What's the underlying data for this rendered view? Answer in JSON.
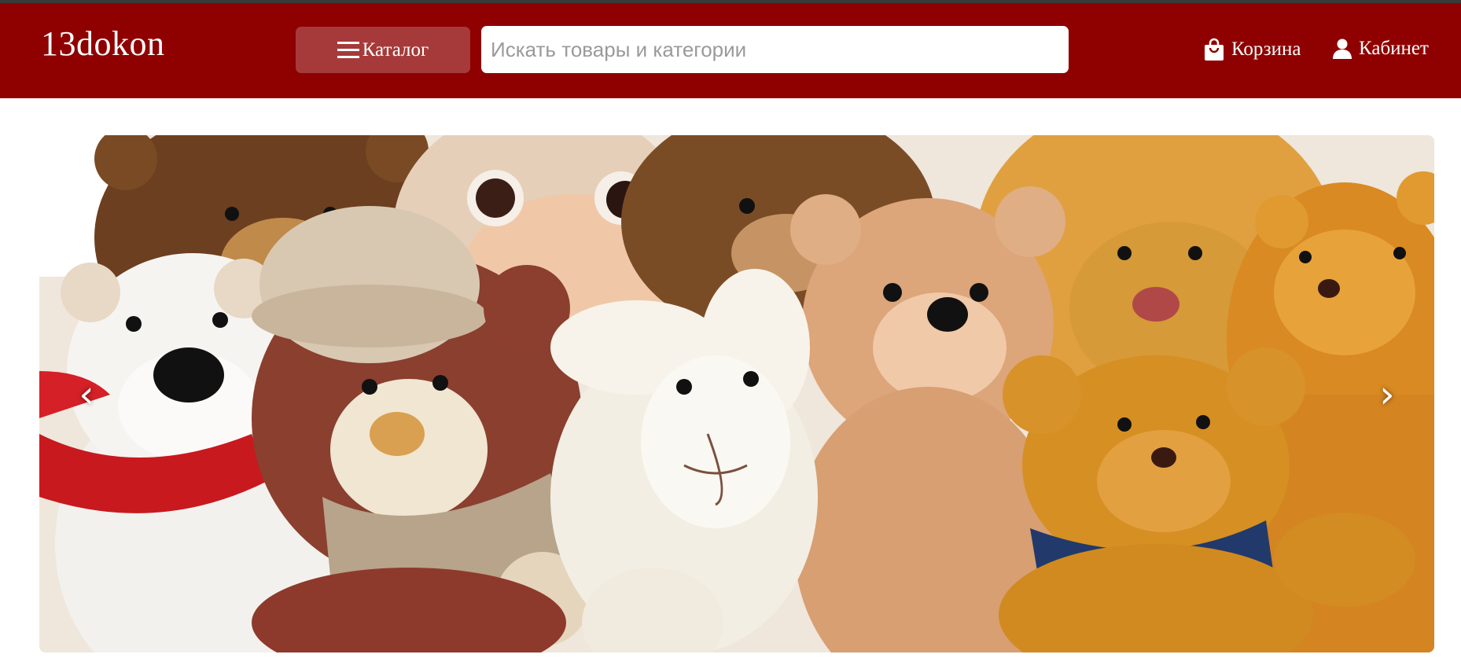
{
  "header": {
    "logo": "13dokon",
    "catalog_label": "Каталог",
    "search_placeholder": "Искать товары и категории",
    "cart_label": "Корзина",
    "cabinet_label": "Кабинет"
  },
  "slider": {
    "prev_arrow": "‹",
    "next_arrow": "›",
    "image_subject": "plush-toys-banner"
  },
  "colors": {
    "header_bg": "#8f0000",
    "catalog_btn_bg": "#a63a3a",
    "text_on_header": "#ffffff"
  },
  "icons": {
    "catalog": "menu-icon",
    "cart": "shopping-bag-icon",
    "cabinet": "user-icon"
  }
}
